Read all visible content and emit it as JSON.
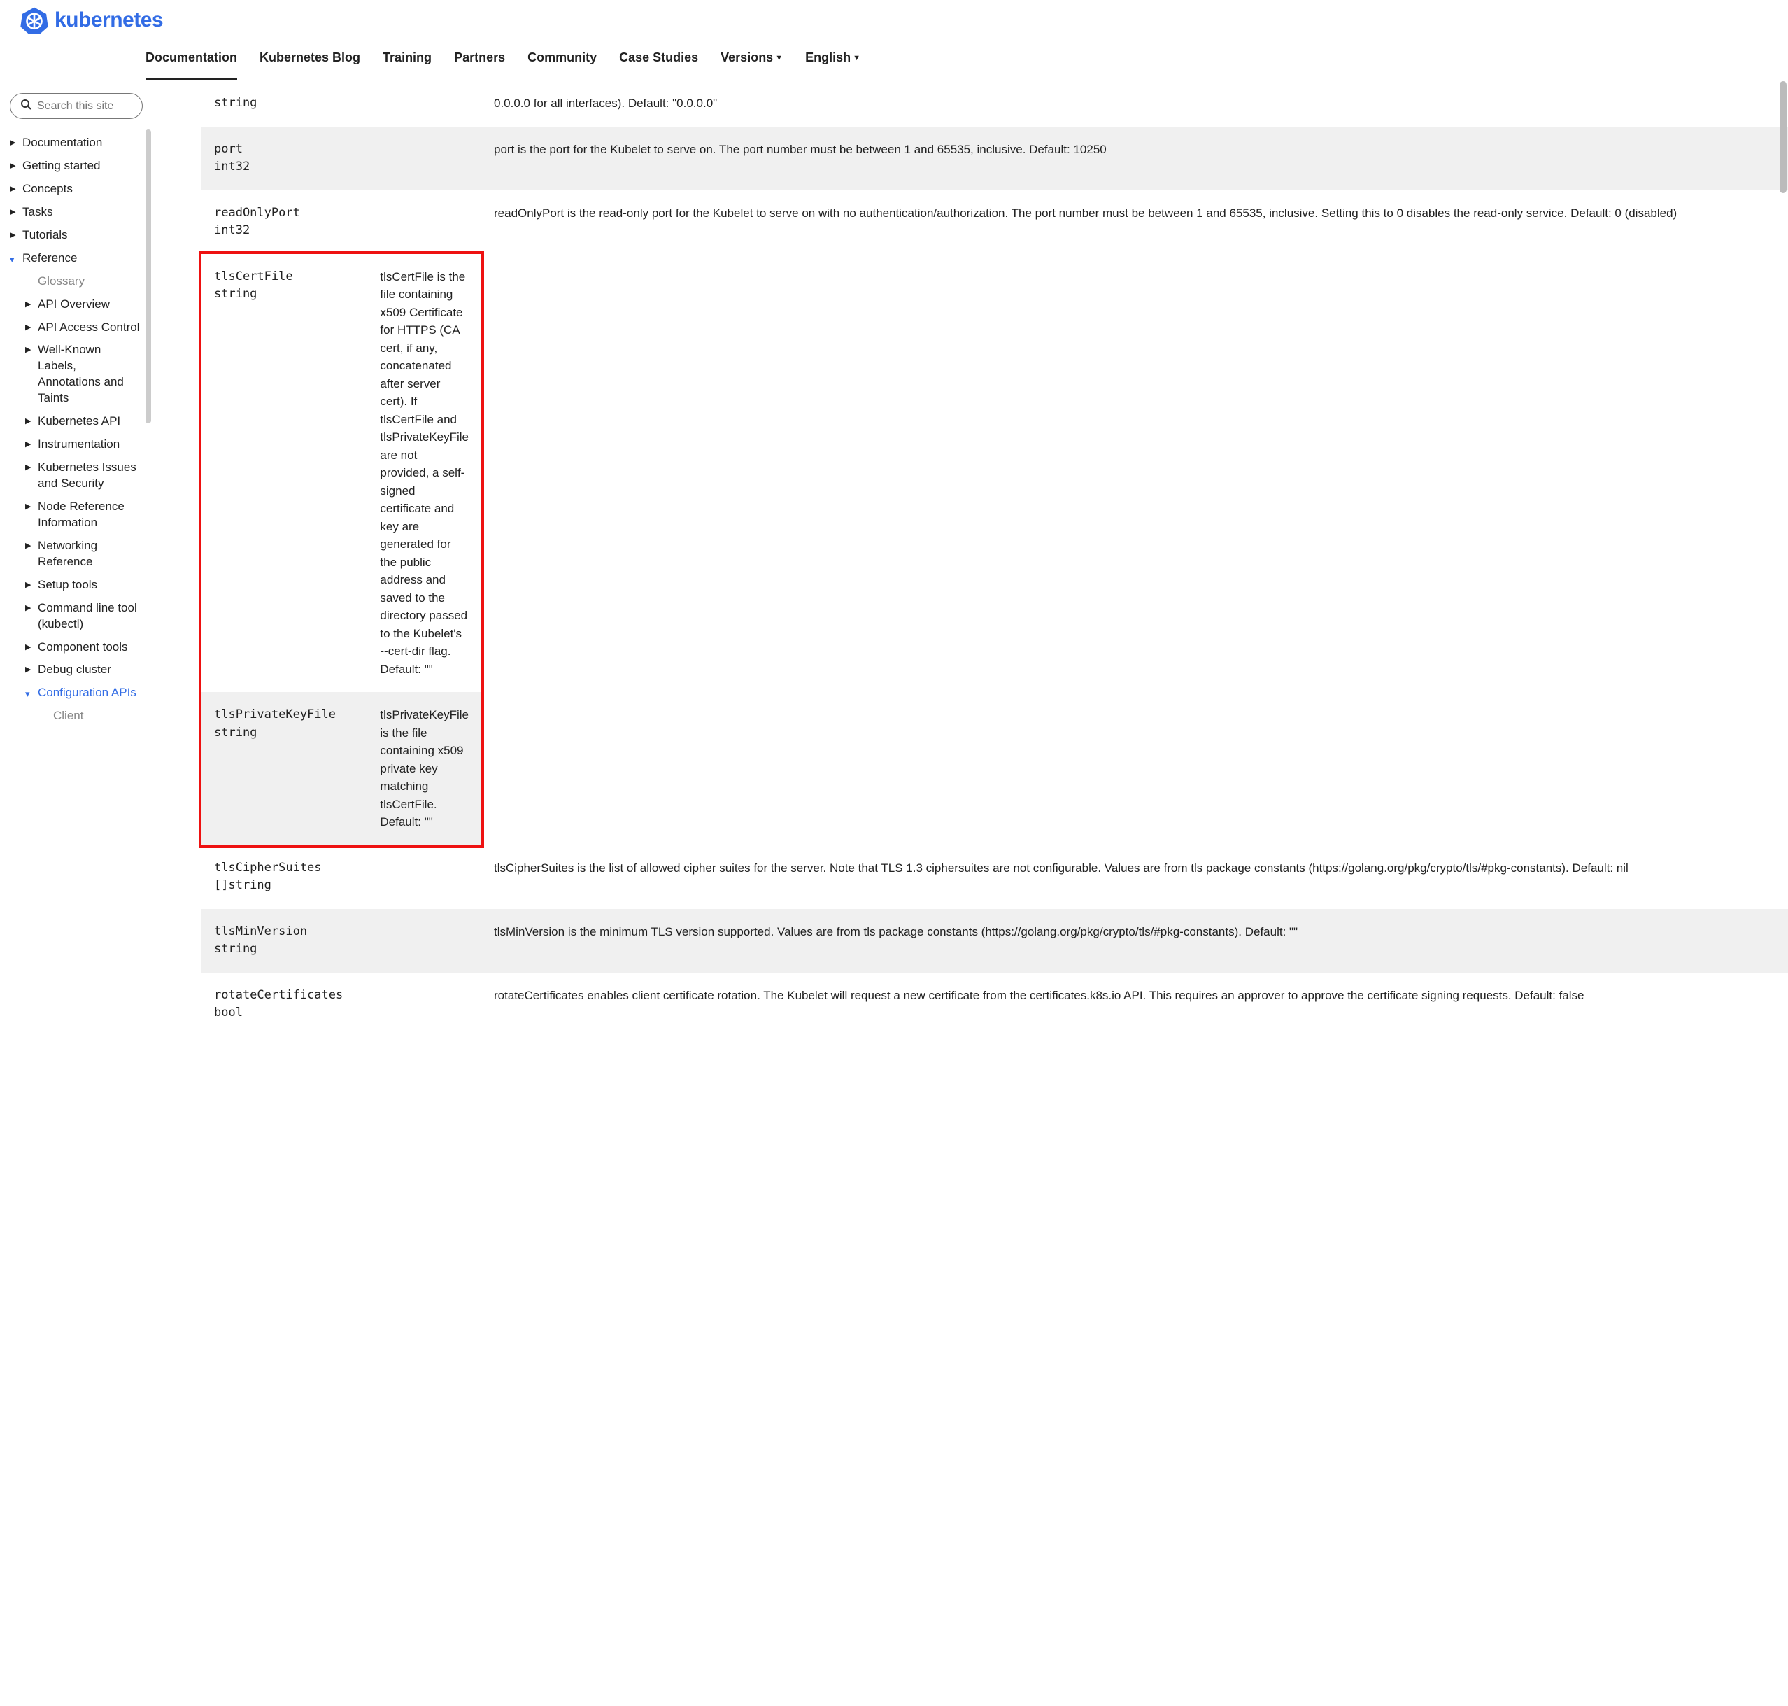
{
  "brand": "kubernetes",
  "nav": [
    {
      "label": "Documentation",
      "active": true
    },
    {
      "label": "Kubernetes Blog"
    },
    {
      "label": "Training"
    },
    {
      "label": "Partners"
    },
    {
      "label": "Community"
    },
    {
      "label": "Case Studies"
    },
    {
      "label": "Versions",
      "dropdown": true
    },
    {
      "label": "English",
      "dropdown": true
    }
  ],
  "search_placeholder": "Search this site",
  "sidebar": {
    "top": [
      {
        "label": "Documentation"
      },
      {
        "label": "Getting started"
      },
      {
        "label": "Concepts"
      },
      {
        "label": "Tasks"
      },
      {
        "label": "Tutorials"
      }
    ],
    "reference_label": "Reference",
    "glossary_label": "Glossary",
    "ref_items": [
      {
        "label": "API Overview"
      },
      {
        "label": "API Access Control"
      },
      {
        "label": "Well-Known Labels, Annotations and Taints"
      },
      {
        "label": "Kubernetes API"
      },
      {
        "label": "Instrumentation"
      },
      {
        "label": "Kubernetes Issues and Security"
      },
      {
        "label": "Node Reference Information"
      },
      {
        "label": "Networking Reference"
      },
      {
        "label": "Setup tools"
      },
      {
        "label": "Command line tool (kubectl)"
      },
      {
        "label": "Component tools"
      },
      {
        "label": "Debug cluster"
      }
    ],
    "config_apis_label": "Configuration APIs",
    "client_label": "Client"
  },
  "rows": [
    {
      "field_type": "string",
      "desc": "0.0.0.0 for all interfaces). Default: \"0.0.0.0\""
    },
    {
      "field": "port",
      "field_type": "int32",
      "desc": "port is the port for the Kubelet to serve on. The port number must be between 1 and 65535, inclusive. Default: 10250"
    },
    {
      "field": "readOnlyPort",
      "field_type": "int32",
      "desc": "readOnlyPort is the read-only port for the Kubelet to serve on with no authentication/authorization. The port number must be between 1 and 65535, inclusive. Setting this to 0 disables the read-only service. Default: 0 (disabled)"
    },
    {
      "field": "tlsCertFile",
      "field_type": "string",
      "desc": "tlsCertFile is the file containing x509 Certificate for HTTPS (CA cert, if any, concatenated after server cert). If tlsCertFile and tlsPrivateKeyFile are not provided, a self-signed certificate and key are generated for the public address and saved to the directory passed to the Kubelet's --cert-dir flag. Default: \"\""
    },
    {
      "field": "tlsPrivateKeyFile",
      "field_type": "string",
      "desc": "tlsPrivateKeyFile is the file containing x509 private key matching tlsCertFile. Default: \"\""
    },
    {
      "field": "tlsCipherSuites",
      "field_type": "[]string",
      "desc": "tlsCipherSuites is the list of allowed cipher suites for the server. Note that TLS 1.3 ciphersuites are not configurable. Values are from tls package constants (https://golang.org/pkg/crypto/tls/#pkg-constants). Default: nil"
    },
    {
      "field": "tlsMinVersion",
      "field_type": "string",
      "desc": "tlsMinVersion is the minimum TLS version supported. Values are from tls package constants (https://golang.org/pkg/crypto/tls/#pkg-constants). Default: \"\""
    },
    {
      "field": "rotateCertificates",
      "field_type": "bool",
      "desc": "rotateCertificates enables client certificate rotation. The Kubelet will request a new certificate from the certificates.k8s.io API. This requires an approver to approve the certificate signing requests. Default: false"
    }
  ]
}
